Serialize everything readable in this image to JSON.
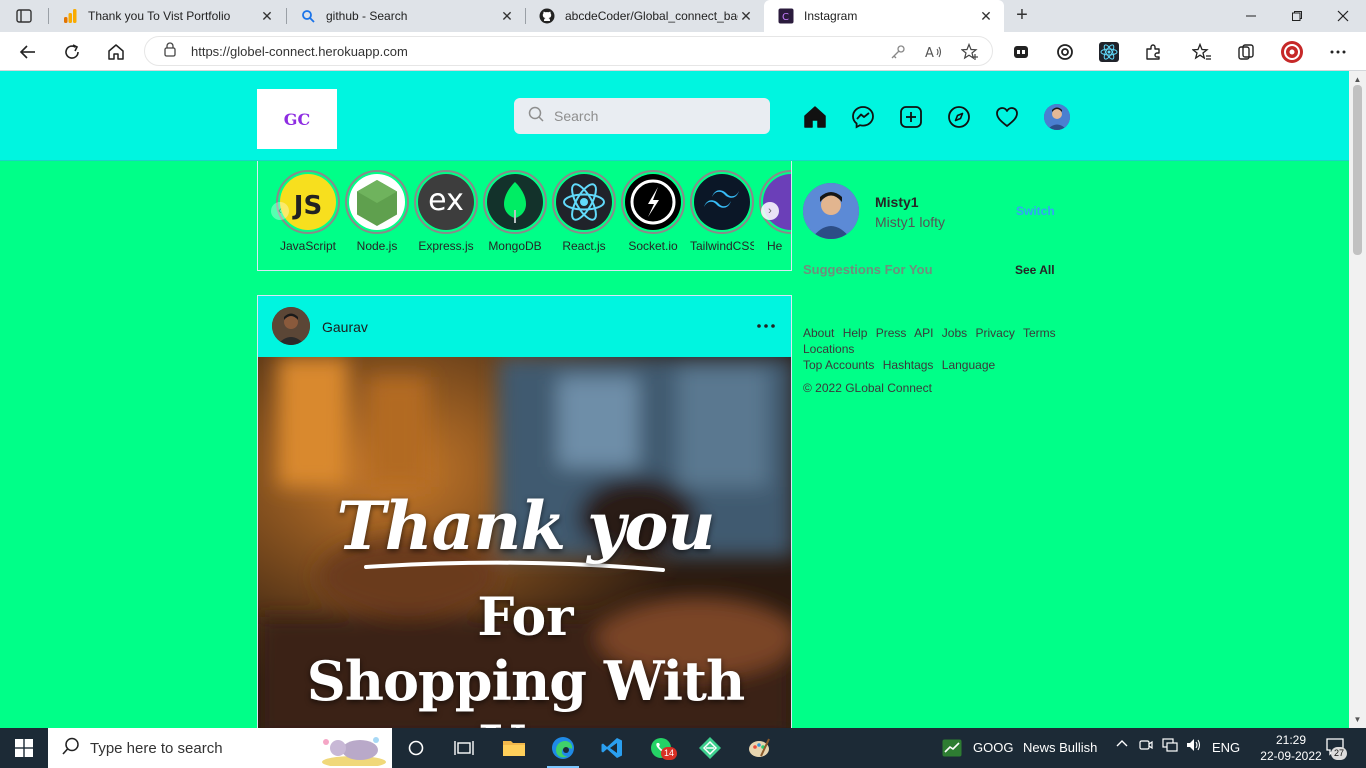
{
  "browser": {
    "tabs": [
      {
        "title": "Thank you To Vist Portfolio",
        "icon": "google-analytics-icon"
      },
      {
        "title": "github - Search",
        "icon": "search-icon"
      },
      {
        "title": "abcdeCoder/Global_connect_bac",
        "icon": "github-icon"
      },
      {
        "title": "Instagram",
        "icon": "site-favicon",
        "active": true
      }
    ],
    "url": "https://globel-connect.herokuapp.com"
  },
  "app": {
    "logo_text": "GC",
    "search_placeholder": "Search",
    "stories": [
      {
        "label": "JavaScript",
        "glyph": "JS",
        "bg": "#f7df1e",
        "fg": "#222222"
      },
      {
        "label": "Node.js",
        "glyph": "",
        "bg": "#ffffff",
        "fg": "#5fa04e"
      },
      {
        "label": "Express.js",
        "glyph": "ex",
        "bg": "#3d3d3d",
        "fg": "#ffffff"
      },
      {
        "label": "MongoDB",
        "glyph": "",
        "bg": "#13322b",
        "fg": "#00ed64"
      },
      {
        "label": "React.js",
        "glyph": "",
        "bg": "#20232a",
        "fg": "#61dafb"
      },
      {
        "label": "Socket.io",
        "glyph": "",
        "bg": "#000000",
        "fg": "#ffffff"
      },
      {
        "label": "TailwindCSS",
        "glyph": "",
        "bg": "#0b1727",
        "fg": "#38bdf8"
      },
      {
        "label": "He",
        "glyph": "",
        "bg": "#6b3fb8",
        "fg": "#ffffff"
      }
    ],
    "post": {
      "username": "Gaurav",
      "image_text": {
        "line1": "Thank you",
        "line2": "For",
        "line3": "Shopping With Us."
      }
    },
    "profile": {
      "username": "Misty1",
      "full_name": "Misty1 lofty",
      "switch_label": "Switch"
    },
    "suggestions_label": "Suggestions For You",
    "see_all_label": "See All",
    "footer_links": [
      "About",
      "Help",
      "Press",
      "API",
      "Jobs",
      "Privacy",
      "Terms",
      "Locations",
      "Top Accounts",
      "Hashtags",
      "Language"
    ],
    "copyright": "© 2022 GLobal Connect"
  },
  "taskbar": {
    "search_placeholder": "Type here to search",
    "stock_text": "GOOG",
    "news_text": "News Bullish",
    "lang": "ENG",
    "time": "21:29",
    "date": "22-09-2022",
    "whatsapp_badge": "14",
    "notification_count": "27"
  }
}
